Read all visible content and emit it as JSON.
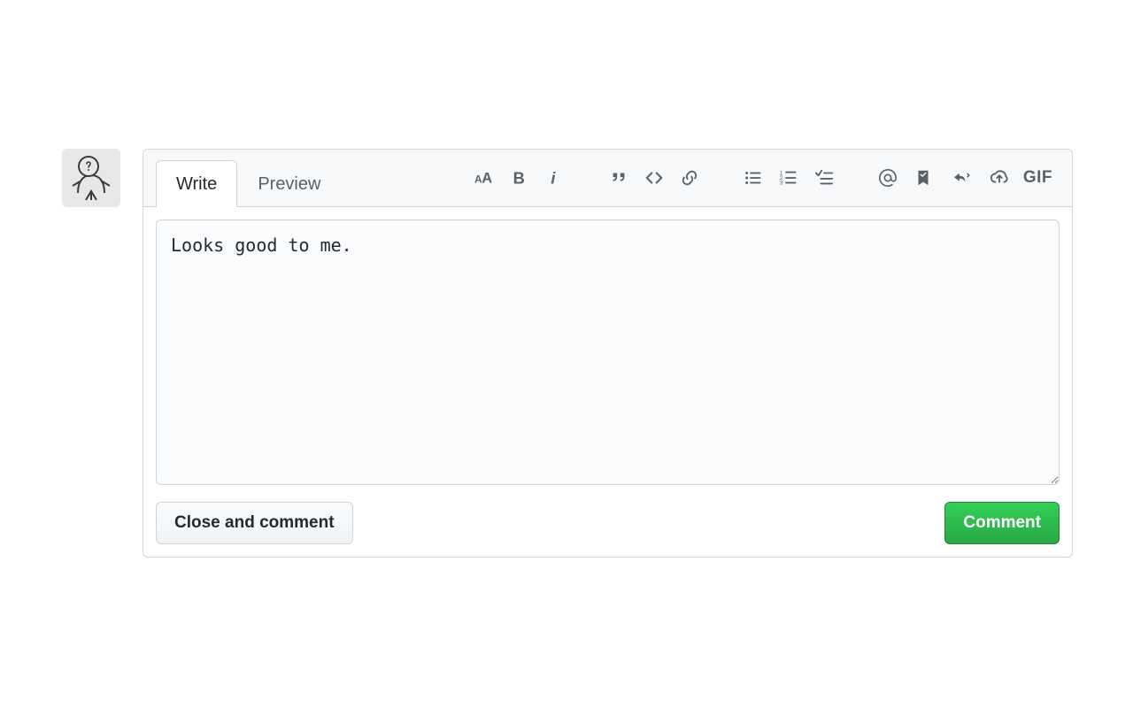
{
  "tabs": {
    "write": "Write",
    "preview": "Preview"
  },
  "comment": {
    "value": "Looks good to me."
  },
  "buttons": {
    "close": "Close and comment",
    "submit": "Comment"
  },
  "toolbar": {
    "gif": "GIF"
  }
}
